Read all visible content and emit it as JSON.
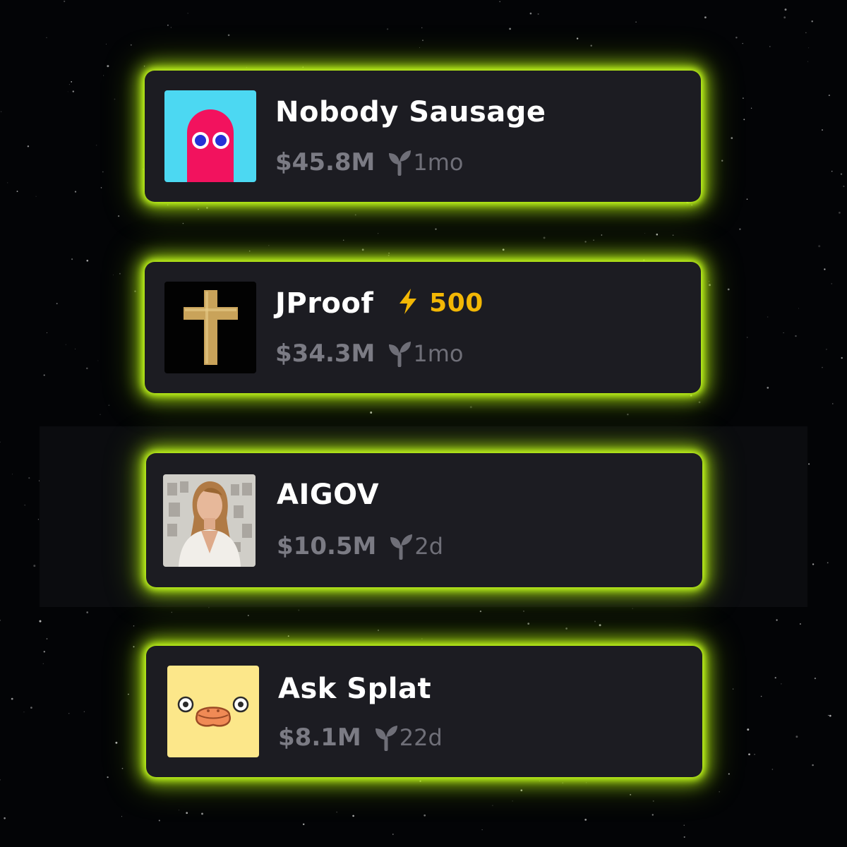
{
  "theme": {
    "accent_glow": "#c9ff1f",
    "card_bg": "#1c1c22",
    "title_color": "#ffffff",
    "meta_color": "#7b7b84",
    "boost_color": "#f2b705"
  },
  "tokens": [
    {
      "name": "Nobody Sausage",
      "market_cap": "$45.8M",
      "age": "1mo",
      "icon": "pink-ghost-avatar",
      "boost": null
    },
    {
      "name": "JProof",
      "market_cap": "$34.3M",
      "age": "1mo",
      "icon": "gold-cross-avatar",
      "boost": "500"
    },
    {
      "name": "AIGOV",
      "market_cap": "$10.5M",
      "age": "2d",
      "icon": "woman-photo-avatar",
      "boost": null
    },
    {
      "name": "Ask Splat",
      "market_cap": "$8.1M",
      "age": "22d",
      "icon": "duck-face-avatar",
      "boost": null
    }
  ]
}
